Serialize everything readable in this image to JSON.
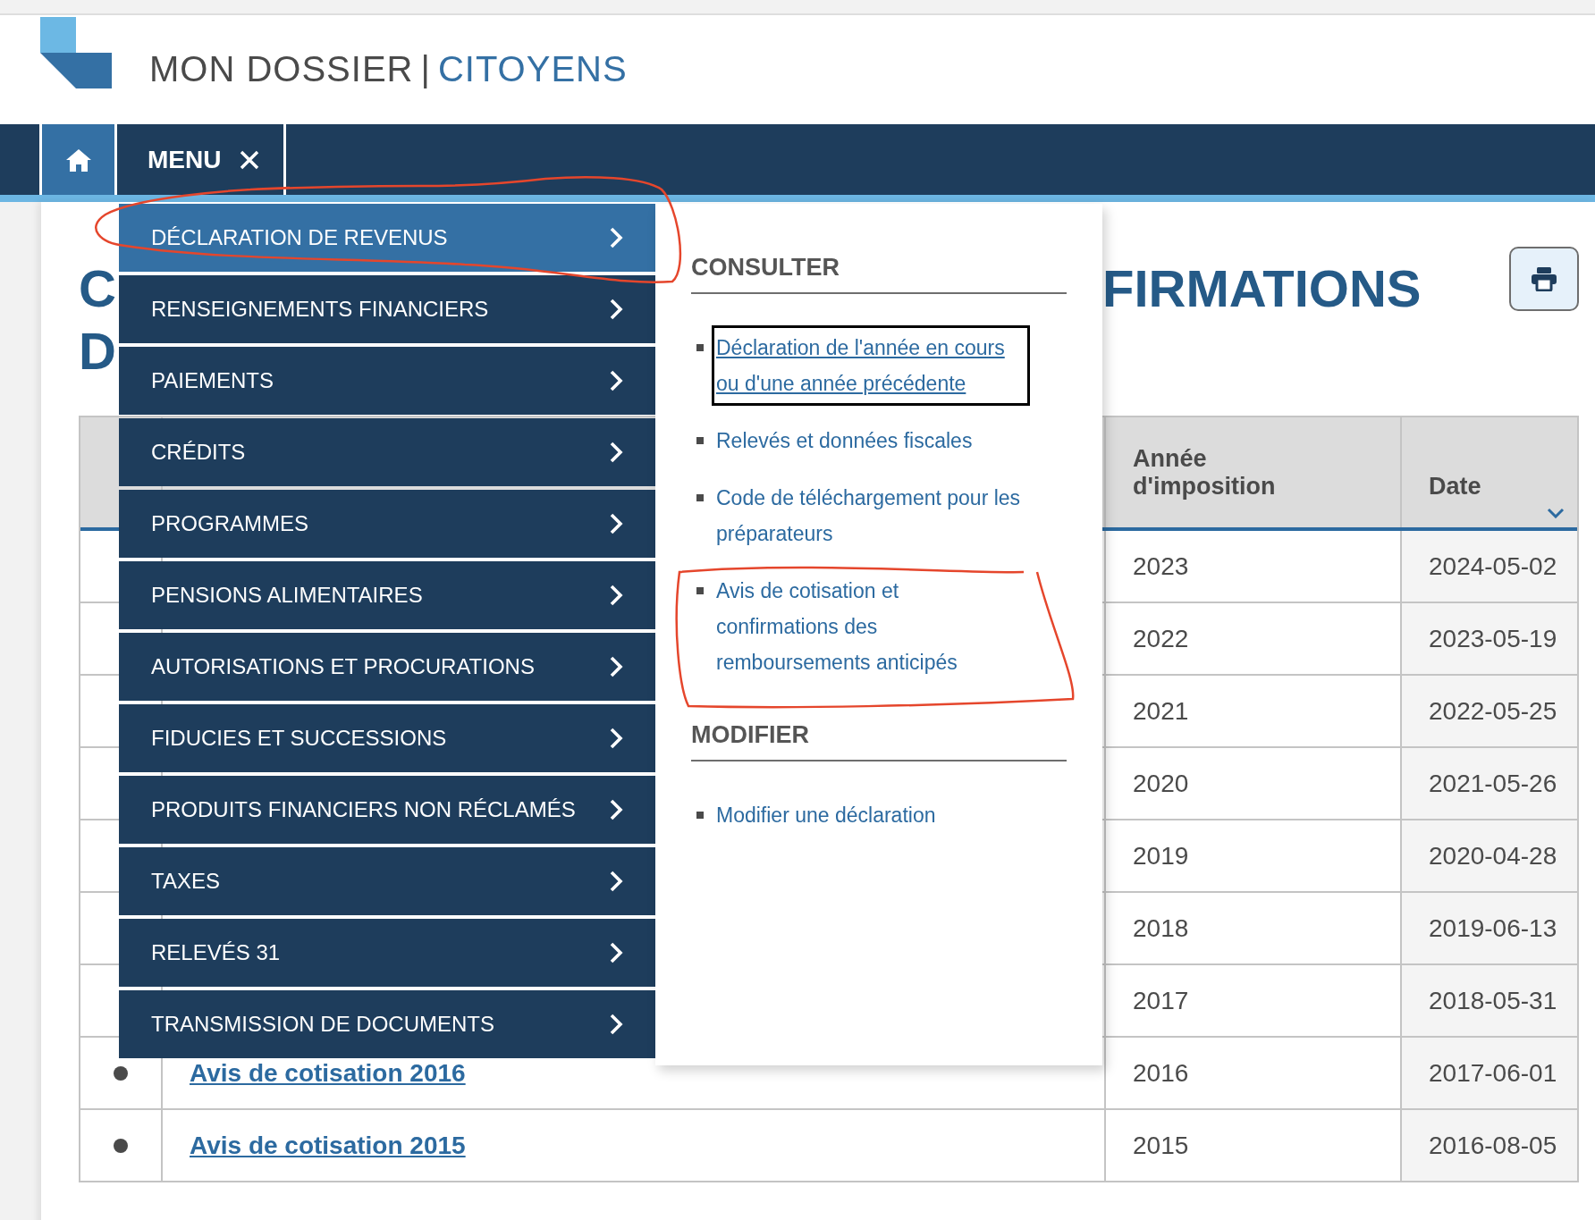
{
  "header": {
    "title_main": "MON DOSSIER",
    "separator": "|",
    "title_accent": "CITOYENS"
  },
  "nav": {
    "menu_label": "MENU"
  },
  "menu": {
    "items": [
      {
        "label": "DÉCLARATION DE REVENUS",
        "selected": true
      },
      {
        "label": "RENSEIGNEMENTS FINANCIERS",
        "selected": false
      },
      {
        "label": "PAIEMENTS",
        "selected": false
      },
      {
        "label": "CRÉDITS",
        "selected": false
      },
      {
        "label": "PROGRAMMES",
        "selected": false
      },
      {
        "label": "PENSIONS ALIMENTAIRES",
        "selected": false
      },
      {
        "label": "AUTORISATIONS ET PROCURATIONS",
        "selected": false
      },
      {
        "label": "FIDUCIES ET SUCCESSIONS",
        "selected": false
      },
      {
        "label": "PRODUITS FINANCIERS NON RÉCLAMÉS",
        "selected": false
      },
      {
        "label": "TAXES",
        "selected": false
      },
      {
        "label": "RELEVÉS 31",
        "selected": false
      },
      {
        "label": "TRANSMISSION DE DOCUMENTS",
        "selected": false
      }
    ]
  },
  "submenu": {
    "sections": [
      {
        "heading": "CONSULTER",
        "links": [
          {
            "text": "Déclaration de l'année en cours\nou d'une année précédente",
            "focused": true
          },
          {
            "text": "Relevés et données fiscales",
            "focused": false
          },
          {
            "text": "Code de téléchargement pour les\npréparateurs",
            "focused": false
          },
          {
            "text": "Avis de cotisation et\nconfirmations des\nremboursements anticipés",
            "focused": false
          }
        ]
      },
      {
        "heading": "MODIFIER",
        "links": [
          {
            "text": "Modifier une déclaration",
            "focused": false
          }
        ]
      }
    ]
  },
  "page": {
    "heading_left": [
      "C",
      "D"
    ],
    "heading_right": "FIRMATIONS",
    "table": {
      "columns": [
        "Année\nd'imposition",
        "Date"
      ],
      "rows": [
        {
          "year": "2023",
          "date": "2024-05-02"
        },
        {
          "year": "2022",
          "date": "2023-05-19"
        },
        {
          "year": "2021",
          "date": "2022-05-25"
        },
        {
          "year": "2020",
          "date": "2021-05-26"
        },
        {
          "year": "2019",
          "date": "2020-04-28"
        },
        {
          "year": "2018",
          "date": "2019-06-13"
        },
        {
          "year": "2017",
          "date": "2018-05-31"
        },
        {
          "link": "Avis de cotisation 2016",
          "year": "2016",
          "date": "2017-06-01"
        },
        {
          "link": "Avis de cotisation 2015",
          "year": "2015",
          "date": "2016-08-05"
        }
      ]
    }
  }
}
